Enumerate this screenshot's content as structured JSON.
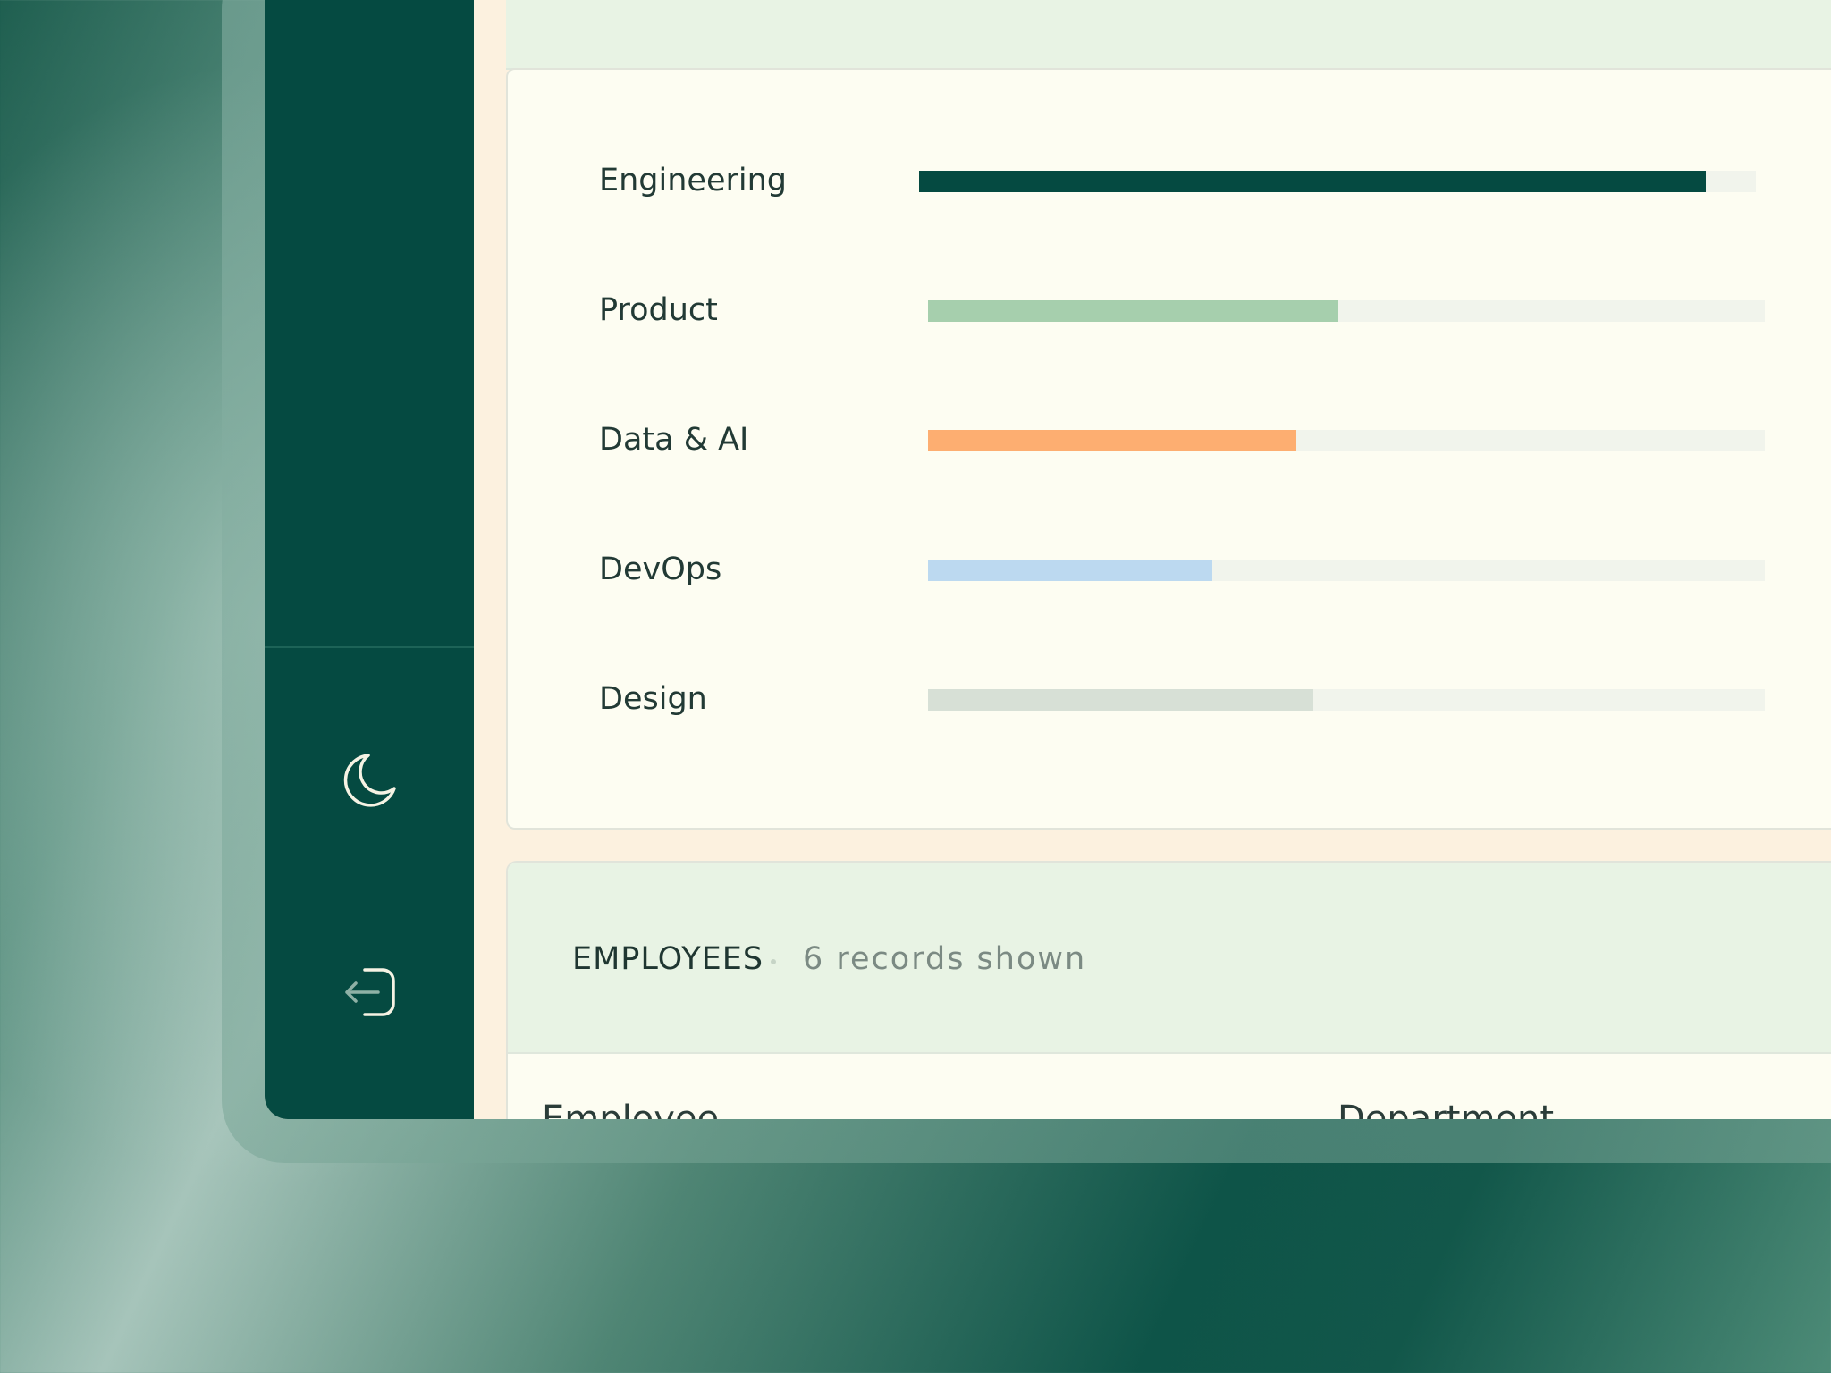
{
  "sidebar": {
    "icons": [
      {
        "name": "moon-icon",
        "label": "theme-toggle"
      },
      {
        "name": "logout-icon",
        "label": "sign-out"
      }
    ]
  },
  "colors": {
    "sidebar": "#054a41",
    "accent_dark": "#054a41",
    "product": "#a6cfad",
    "data_ai": "#fdae71",
    "devops": "#bcd9f0",
    "design": "#d7e0d6"
  },
  "chart_data": {
    "type": "bar",
    "orientation": "horizontal",
    "categories": [
      "Engineering",
      "Product",
      "Data & AI",
      "DevOps",
      "Design"
    ],
    "values": [
      94,
      49,
      44,
      34,
      46
    ],
    "xlim": [
      0,
      100
    ],
    "colors": [
      "#054a41",
      "#a6cfad",
      "#fdae71",
      "#bcd9f0",
      "#d7e0d6"
    ],
    "grid": false
  },
  "employees": {
    "title": "EMPLOYEES",
    "count_text": "6 records shown",
    "columns": [
      "Employee",
      "Department"
    ]
  }
}
